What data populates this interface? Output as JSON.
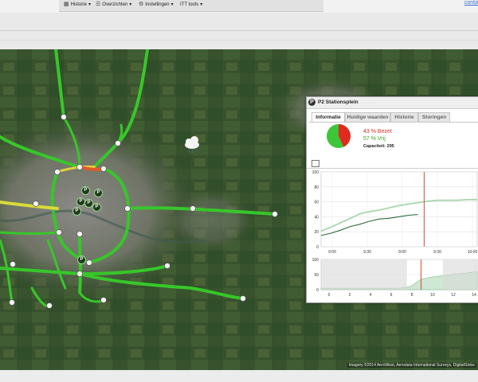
{
  "menu": {
    "items": [
      {
        "label": "Historie",
        "icon": "grid-icon"
      },
      {
        "label": "Overzichten",
        "icon": "list-icon"
      },
      {
        "label": "Instellingen",
        "icon": "gear-icon"
      },
      {
        "label": "ITT tools",
        "icon": ""
      }
    ],
    "caret": "▾",
    "contact": "conta"
  },
  "map": {
    "attribution": "Imagery ©2014 AeroWest, Aerodata International Surveys, DigitalGlobe",
    "parking_marker": "P",
    "weather_icon": "cloud-rain-icon",
    "colors": {
      "free": "#3ecf2a",
      "busy": "#f0d63a",
      "jam": "#e0472c"
    }
  },
  "popup": {
    "title": "P2 Stationsplein",
    "icon_label": "P",
    "tabs": [
      "Informatie",
      "Huidige waarden",
      "Historie",
      "Storingen"
    ],
    "active_tab": "Informatie",
    "occupied_text": "43 % Bezet",
    "free_text": "57 % Vrij",
    "capacity_text": "Capaciteit: 295",
    "colors": {
      "occupied": "#e02a1f",
      "free": "#3aa51f"
    }
  },
  "chart_data": [
    {
      "type": "line",
      "title": "",
      "x_ticks": [
        "9:00",
        "9:30",
        "9:00",
        "9:30",
        "10:00"
      ],
      "ylim": [
        0,
        100
      ],
      "y_ticks": [
        0,
        20,
        40,
        60,
        80,
        100
      ],
      "series": [
        {
          "values": [
            15,
            18,
            22,
            27,
            30,
            34,
            37,
            38,
            40,
            42,
            43
          ],
          "color": "#2f6b3c"
        },
        {
          "values": [
            21,
            26,
            32,
            38,
            44,
            47,
            49,
            52,
            55,
            57,
            59,
            61,
            62,
            62,
            62,
            63,
            63
          ],
          "color": "#a9d6ad"
        }
      ],
      "marker_color": "#d2352a",
      "grid": true
    },
    {
      "type": "area",
      "title": "",
      "x_ticks": [
        "0",
        "2",
        "4",
        "6",
        "8",
        "10",
        "12",
        "14"
      ],
      "ylim": [
        0,
        100
      ],
      "y_ticks": [
        0,
        50,
        100
      ],
      "values": [
        5,
        5,
        5,
        5,
        5,
        5,
        5,
        5,
        10,
        35,
        42,
        46,
        52,
        55,
        60
      ],
      "marker_color": "#d2352a",
      "grid": true
    }
  ]
}
